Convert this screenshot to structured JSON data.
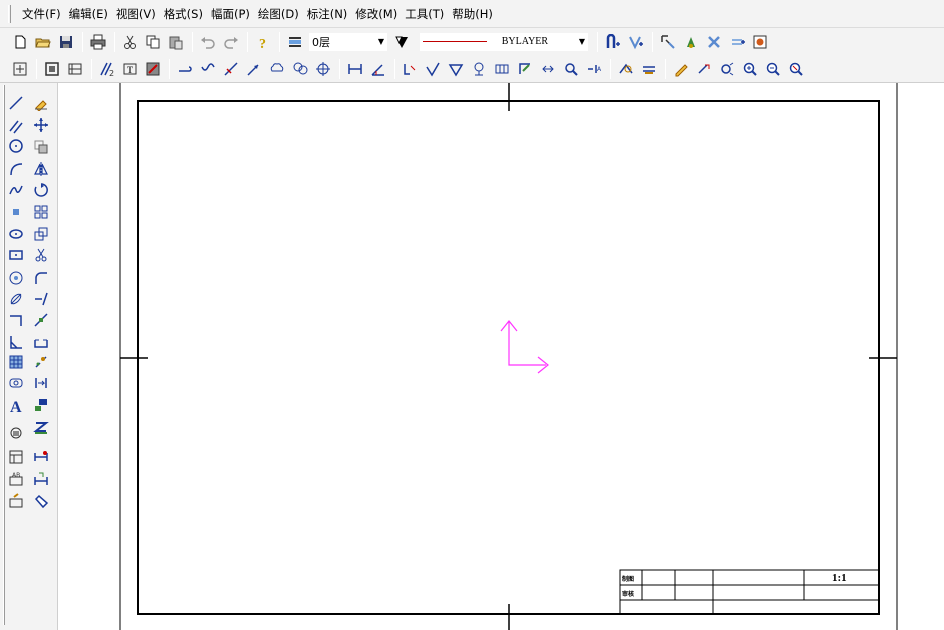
{
  "menu": {
    "items": [
      {
        "label": "文件(F)"
      },
      {
        "label": "编辑(E)"
      },
      {
        "label": "视图(V)"
      },
      {
        "label": "格式(S)"
      },
      {
        "label": "幅面(P)"
      },
      {
        "label": "绘图(D)"
      },
      {
        "label": "标注(N)"
      },
      {
        "label": "修改(M)"
      },
      {
        "label": "工具(T)"
      },
      {
        "label": "帮助(H)"
      }
    ]
  },
  "toolbar": {
    "layer_value": "0层",
    "linetype_value": "BYLAYER"
  },
  "title_block": {
    "scale": "1:1",
    "row1_label": "制图",
    "row2_label": "审核"
  },
  "colors": {
    "ucs_icon": "#ff33ff",
    "linetype_sample": "#c00000",
    "border": "#000000"
  }
}
